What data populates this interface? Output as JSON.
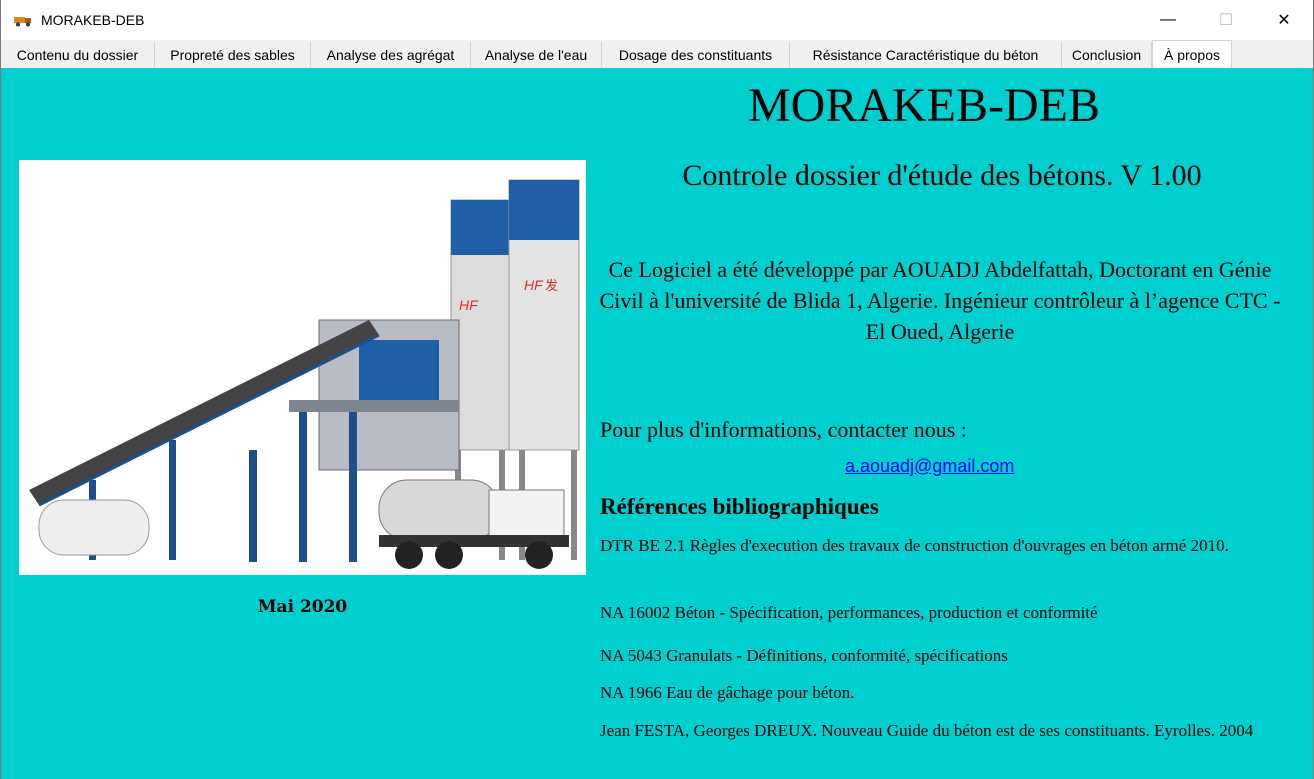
{
  "window": {
    "title": "MORAKEB-DEB",
    "controls": {
      "minimize": "—",
      "maximize": "☐",
      "close": "✕"
    }
  },
  "tabs": [
    {
      "label": "Contenu du dossier",
      "active": false
    },
    {
      "label": "Propreté des sables",
      "active": false
    },
    {
      "label": "Analyse des agrégat",
      "active": false
    },
    {
      "label": "Analyse de l'eau",
      "active": false
    },
    {
      "label": "Dosage des constituants",
      "active": false
    },
    {
      "label": "Résistance Caractéristique du béton",
      "active": false
    },
    {
      "label": "Conclusion",
      "active": false
    },
    {
      "label": "À propos",
      "active": true
    }
  ],
  "about": {
    "app_title": "MORAKEB-DEB",
    "subtitle": "Controle dossier d'étude des bétons. V 1.00",
    "author": "Ce Logiciel a été développé par AOUADJ Abdelfattah, Doctorant en Génie Civil à l'université de Blida 1, Algerie. Ingénieur contrôleur à l’agence CTC -El Oued, Algerie",
    "contact_label": "Pour plus d'informations, contacter nous :",
    "email": "a.aouadj@gmail.com",
    "date": "Mai 2020",
    "photo_icon": "concrete-plant-image",
    "photo_markings": [
      "HF",
      "HF",
      "发"
    ]
  },
  "references": {
    "title": "Références bibliographiques",
    "items": [
      "DTR BE 2.1 Règles d'execution des travaux de construction d'ouvrages en béton armé 2010.",
      "NA 16002 Béton - Spécification, performances, production et conformité",
      "NA 5043 Granulats - Définitions, conformité, spécifications",
      "NA 1966 Eau de gâchage pour béton.",
      "Jean FESTA, Georges DREUX. Nouveau Guide du béton est de ses constituants. Eyrolles. 2004"
    ]
  },
  "colors": {
    "background": "#00cfcf",
    "link": "#0000ee"
  }
}
